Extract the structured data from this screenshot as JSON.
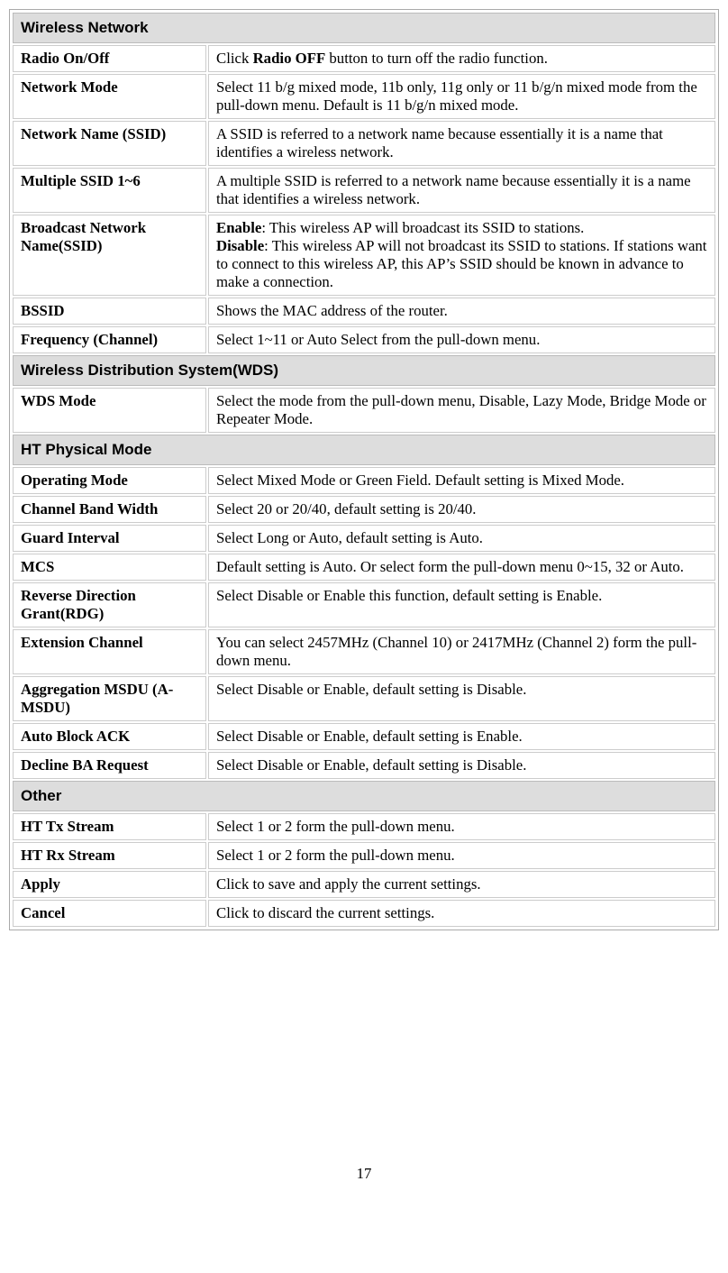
{
  "sections": [
    {
      "header": "Wireless Network",
      "rows": [
        {
          "label": "Radio On/Off",
          "desc_pre": "Click ",
          "desc_bold": "Radio OFF",
          "desc_post": " button to turn off the radio function."
        },
        {
          "label": "Network Mode",
          "desc": "Select 11 b/g mixed mode, 11b only, 11g only or 11 b/g/n mixed mode from the pull-down menu. Default is 11 b/g/n mixed mode."
        },
        {
          "label": "Network Name (SSID)",
          "desc": "A SSID is referred to a network name because essentially it is a name that identifies a wireless network."
        },
        {
          "label": "Multiple SSID 1~6",
          "desc": "A multiple SSID is referred to a network name because essentially it is a name that identifies a wireless network."
        },
        {
          "label": "Broadcast Network Name(SSID)",
          "enable_label": "Enable",
          "enable_text": ": This wireless AP will broadcast its SSID to stations.",
          "disable_label": "Disable",
          "disable_text": ": This wireless AP will not broadcast its SSID to stations. If stations want to connect to this wireless AP, this AP’s SSID should be known in advance to make a connection."
        },
        {
          "label": "BSSID",
          "desc": "Shows the MAC address of the router."
        },
        {
          "label": "Frequency (Channel)",
          "desc": "Select 1~11 or Auto Select from the pull-down menu."
        }
      ]
    },
    {
      "header": "Wireless Distribution System(WDS)",
      "rows": [
        {
          "label": "WDS Mode",
          "desc": "Select the mode from the pull-down menu, Disable, Lazy Mode, Bridge Mode or Repeater Mode."
        }
      ]
    },
    {
      "header": "HT Physical Mode",
      "rows": [
        {
          "label": "Operating Mode",
          "desc": "Select Mixed Mode or Green Field. Default setting is Mixed Mode."
        },
        {
          "label": "Channel Band Width",
          "desc": "Select 20 or 20/40, default setting is 20/40."
        },
        {
          "label": "Guard Interval",
          "desc": "Select Long or Auto, default setting is Auto."
        },
        {
          "label": "MCS",
          "desc": "Default setting is Auto. Or select form the pull-down menu 0~15, 32 or Auto."
        },
        {
          "label": "Reverse Direction Grant(RDG)",
          "desc": "Select Disable or Enable this function, default setting is Enable."
        },
        {
          "label": "Extension Channel",
          "desc": "You can select 2457MHz (Channel 10) or 2417MHz (Channel 2) form the pull-down menu."
        },
        {
          "label": "Aggregation MSDU (A-MSDU)",
          "desc": "Select Disable or Enable, default setting is Disable."
        },
        {
          "label": "Auto Block ACK",
          "desc": "Select Disable or Enable, default setting is Enable."
        },
        {
          "label": "Decline BA Request",
          "desc": "Select Disable or Enable, default setting is Disable."
        }
      ]
    },
    {
      "header": "Other",
      "rows": [
        {
          "label": "HT Tx Stream",
          "desc": "Select 1 or 2 form the pull-down menu."
        },
        {
          "label": "HT Rx Stream",
          "desc": "Select 1 or 2 form the pull-down menu."
        },
        {
          "label": "Apply",
          "desc": "Click to save and apply the current settings."
        },
        {
          "label": "Cancel",
          "desc": "Click to discard the current settings."
        }
      ]
    }
  ],
  "page_number": "17"
}
